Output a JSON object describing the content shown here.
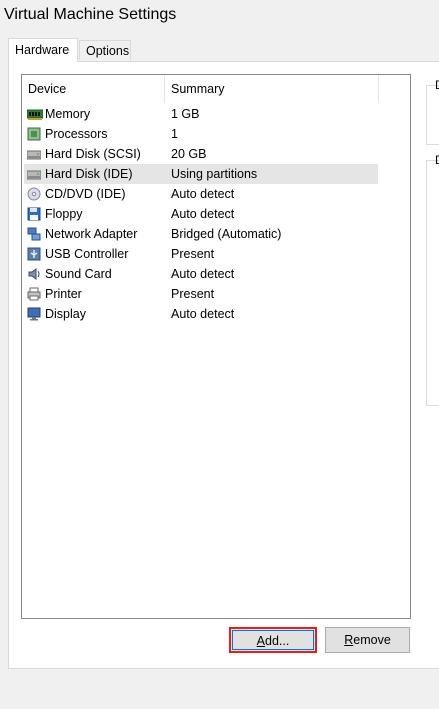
{
  "window": {
    "title": "Virtual Machine Settings"
  },
  "tabs": [
    {
      "label": "Hardware",
      "active": true
    },
    {
      "label": "Options",
      "active": false
    }
  ],
  "table": {
    "columns": [
      "Device",
      "Summary"
    ],
    "rows": [
      {
        "device": "Memory",
        "summary": "1 GB",
        "icon": "memory-icon"
      },
      {
        "device": "Processors",
        "summary": "1",
        "icon": "processor-icon"
      },
      {
        "device": "Hard Disk (SCSI)",
        "summary": "20 GB",
        "icon": "hard-disk-icon"
      },
      {
        "device": "Hard Disk (IDE)",
        "summary": "Using partitions",
        "icon": "hard-disk-icon",
        "selected": true
      },
      {
        "device": "CD/DVD (IDE)",
        "summary": "Auto detect",
        "icon": "cd-dvd-icon"
      },
      {
        "device": "Floppy",
        "summary": "Auto detect",
        "icon": "floppy-icon"
      },
      {
        "device": "Network Adapter",
        "summary": "Bridged (Automatic)",
        "icon": "network-adapter-icon"
      },
      {
        "device": "USB Controller",
        "summary": "Present",
        "icon": "usb-icon"
      },
      {
        "device": "Sound Card",
        "summary": "Auto detect",
        "icon": "sound-card-icon"
      },
      {
        "device": "Printer",
        "summary": "Present",
        "icon": "printer-icon"
      },
      {
        "device": "Display",
        "summary": "Auto detect",
        "icon": "display-icon"
      }
    ]
  },
  "buttons": {
    "add_prefix": "",
    "add_mnemonic": "A",
    "add_rest": "dd...",
    "remove_mnemonic": "R",
    "remove_rest": "emove"
  },
  "side": {
    "label1": "D",
    "label2": "D"
  },
  "colors": {
    "highlight": "#e02020",
    "selected_row": "#e5e5e5"
  }
}
